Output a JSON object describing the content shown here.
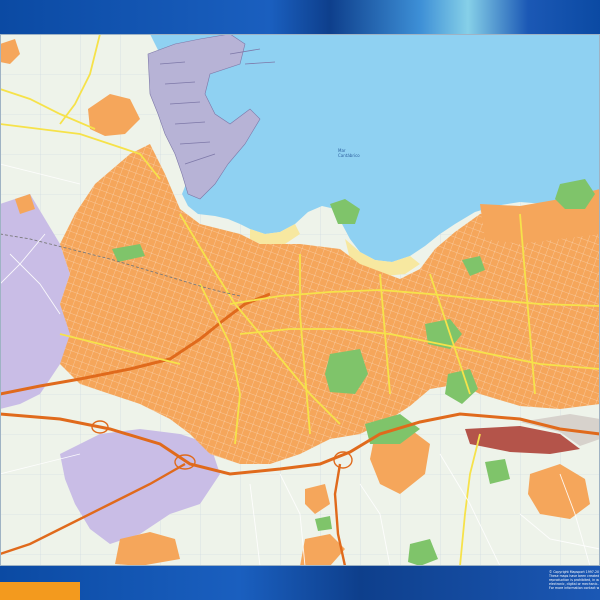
{
  "map": {
    "sea_label_line1": "Mar",
    "sea_label_line2": "Cantábrico"
  },
  "copyright": {
    "line1": "© Copyright Mapsport 1997-2017",
    "line2": "These maps have been created ...",
    "line3": "reproduction is prohibited, in w...",
    "line4": "electronic, digital or mechanic...",
    "line5": "For more information contact w..."
  },
  "colors": {
    "sea": "#8fd1f2",
    "urban": "#f5a65b",
    "suburb": "#c9bde6",
    "park": "#7fc46a",
    "industrial": "#b4544a",
    "highway": "#e06a1c",
    "main_road": "#f6e24a",
    "background": "#eef3ea",
    "band": "#0b4aa3",
    "tab": "#f39a1e"
  }
}
